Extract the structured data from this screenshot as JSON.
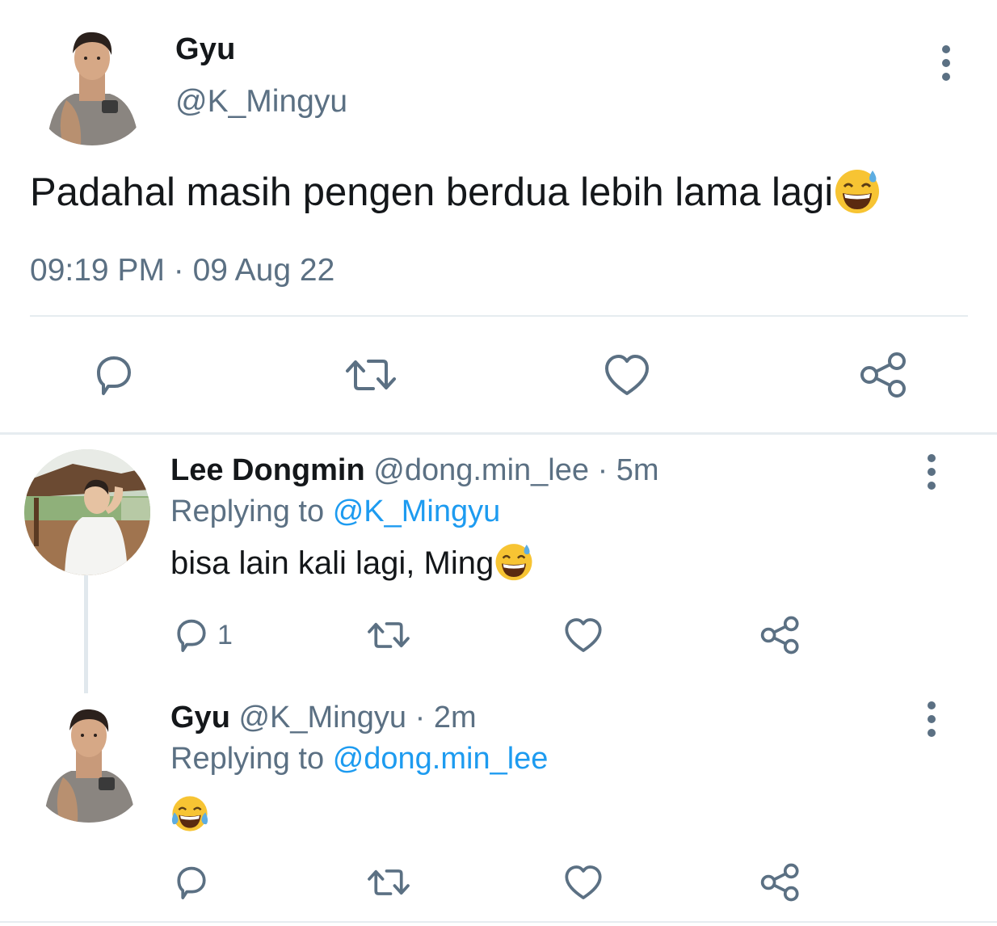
{
  "main_tweet": {
    "name": "Gyu",
    "handle": "@K_Mingyu",
    "text": "Padahal masih pengen berdua lebih lama lagi",
    "text_emoji": "grinning-face-with-sweat-icon",
    "timestamp": "09:19 PM · 09 Aug 22",
    "actions": [
      "reply-icon",
      "retweet-icon",
      "like-icon",
      "share-icon"
    ]
  },
  "replies": [
    {
      "name": "Lee Dongmin",
      "handle": "@dong.min_lee",
      "separator": "·",
      "time": "5m",
      "replying_label": "Replying to",
      "replying_to": "@K_Mingyu",
      "text": "bisa lain kali lagi, Ming",
      "text_emoji": "grinning-face-with-sweat-icon",
      "reply_count": "1"
    },
    {
      "name": "Gyu",
      "handle": "@K_Mingyu",
      "separator": "·",
      "time": "2m",
      "replying_label": "Replying to",
      "replying_to": "@dong.min_lee",
      "text": "",
      "text_emoji": "face-with-tears-of-joy-icon",
      "reply_count": ""
    }
  ],
  "colors": {
    "text": "#14171a",
    "secondary": "#5b7083",
    "link": "#1d9bf0",
    "divider": "#e6ecf0"
  }
}
